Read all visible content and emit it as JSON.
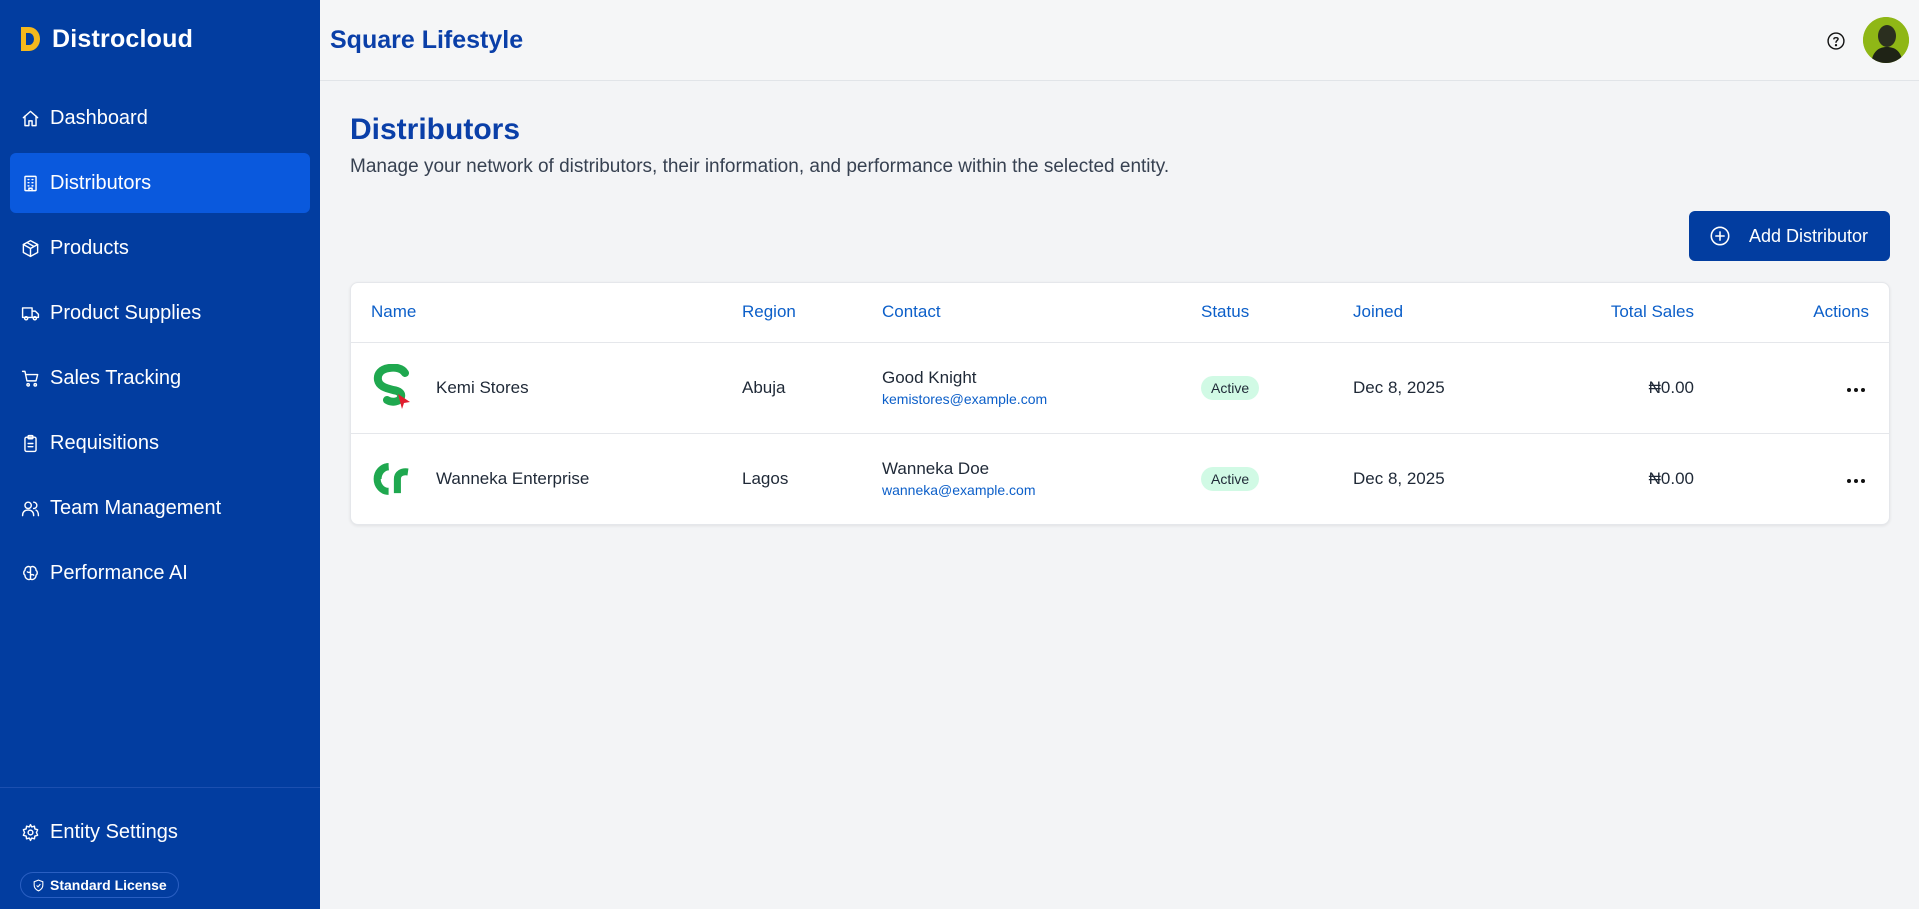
{
  "brand": {
    "name": "Distrocloud",
    "accent": "#f5b81c"
  },
  "sidebar": {
    "items": [
      {
        "label": "Dashboard",
        "icon": "home-icon"
      },
      {
        "label": "Distributors",
        "icon": "building-icon",
        "active": true
      },
      {
        "label": "Products",
        "icon": "package-icon"
      },
      {
        "label": "Product Supplies",
        "icon": "truck-icon"
      },
      {
        "label": "Sales Tracking",
        "icon": "cart-icon"
      },
      {
        "label": "Requisitions",
        "icon": "clipboard-icon"
      },
      {
        "label": "Team Management",
        "icon": "users-icon"
      },
      {
        "label": "Performance AI",
        "icon": "brain-icon"
      }
    ],
    "settings_label": "Entity Settings",
    "license_label": "Standard License"
  },
  "header": {
    "title": "Square Lifestyle"
  },
  "page": {
    "title": "Distributors",
    "subtitle": "Manage your network of distributors, their information, and performance within the selected entity.",
    "add_button_label": "Add Distributor"
  },
  "table": {
    "columns": [
      "Name",
      "Region",
      "Contact",
      "Status",
      "Joined",
      "Total Sales",
      "Actions"
    ],
    "rows": [
      {
        "name": "Kemi Stores",
        "region": "Abuja",
        "contact_name": "Good Knight",
        "contact_email": "kemistores@example.com",
        "status": "Active",
        "joined": "Dec 8, 2025",
        "total_sales": "₦0.00"
      },
      {
        "name": "Wanneka Enterprise",
        "region": "Lagos",
        "contact_name": "Wanneka Doe",
        "contact_email": "wanneka@example.com",
        "status": "Active",
        "joined": "Dec 8, 2025",
        "total_sales": "₦0.00"
      }
    ]
  },
  "colors": {
    "sidebar_bg": "#023da0",
    "active_bg": "#0a59dd",
    "primary_text": "#0a3fa8",
    "badge_bg": "#d1fae5"
  }
}
